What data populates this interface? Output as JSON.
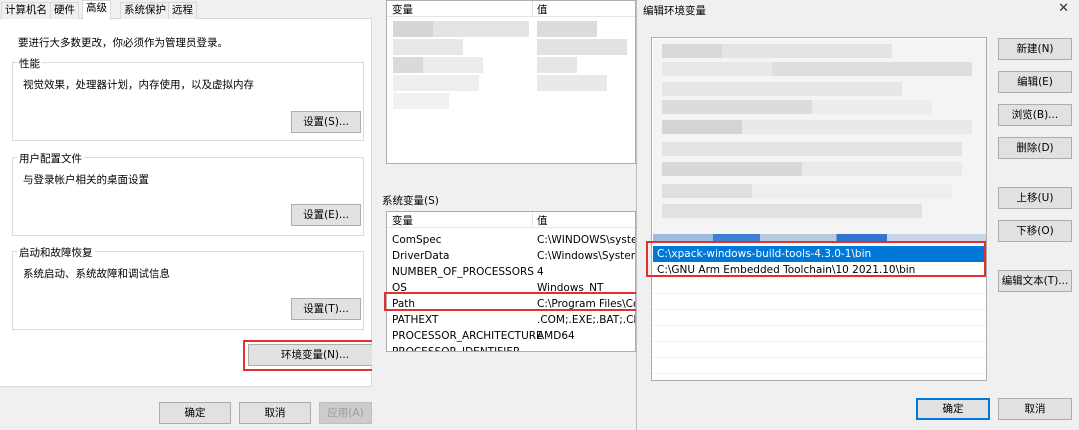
{
  "system_properties": {
    "tabs": [
      "计算机名",
      "硬件",
      "高级",
      "系统保护",
      "远程"
    ],
    "active_tab": "高级",
    "admin_note": "要进行大多数更改，你必须作为管理员登录。",
    "performance": {
      "title": "性能",
      "description": "视觉效果，处理器计划，内存使用，以及虚拟内存",
      "button": "设置(S)..."
    },
    "user_profiles": {
      "title": "用户配置文件",
      "description": "与登录帐户相关的桌面设置",
      "button": "设置(E)..."
    },
    "startup_recovery": {
      "title": "启动和故障恢复",
      "description": "系统启动、系统故障和调试信息",
      "button": "设置(T)..."
    },
    "env_button": "环境变量(N)...",
    "ok": "确定",
    "cancel": "取消",
    "apply": "应用(A)"
  },
  "env_vars": {
    "user_list": {
      "header_name": "变量",
      "header_value": "值"
    },
    "system_title": "系统变量(S)",
    "system_list": {
      "header_name": "变量",
      "header_value": "值",
      "rows": [
        {
          "name": "ComSpec",
          "value": "C:\\WINDOWS\\system"
        },
        {
          "name": "DriverData",
          "value": "C:\\Windows\\System3"
        },
        {
          "name": "NUMBER_OF_PROCESSORS",
          "value": "4"
        },
        {
          "name": "OS",
          "value": "Windows_NT"
        },
        {
          "name": "Path",
          "value": "C:\\Program Files\\Co"
        },
        {
          "name": "PATHEXT",
          "value": ".COM;.EXE;.BAT;.CMD"
        },
        {
          "name": "PROCESSOR_ARCHITECTURE",
          "value": "AMD64"
        },
        {
          "name": "PROCESSOR_IDENTIFIER",
          "value": ""
        }
      ]
    }
  },
  "edit_env": {
    "title": "编辑环境变量",
    "close_icon": "close-icon",
    "entries": [
      {
        "text": "C:\\xpack-windows-build-tools-4.3.0-1\\bin",
        "selected": true
      },
      {
        "text": "C:\\GNU Arm Embedded Toolchain\\10 2021.10\\bin",
        "selected": false
      }
    ],
    "buttons": {
      "new": "新建(N)",
      "edit": "编辑(E)",
      "browse": "浏览(B)...",
      "delete": "删除(D)",
      "move_up": "上移(U)",
      "move_down": "下移(O)",
      "edit_text": "编辑文本(T)..."
    },
    "ok": "确定",
    "cancel": "取消"
  },
  "colors": {
    "selection": "#0078d7",
    "highlight_box": "#e03030",
    "focus_border": "#0078d7"
  }
}
